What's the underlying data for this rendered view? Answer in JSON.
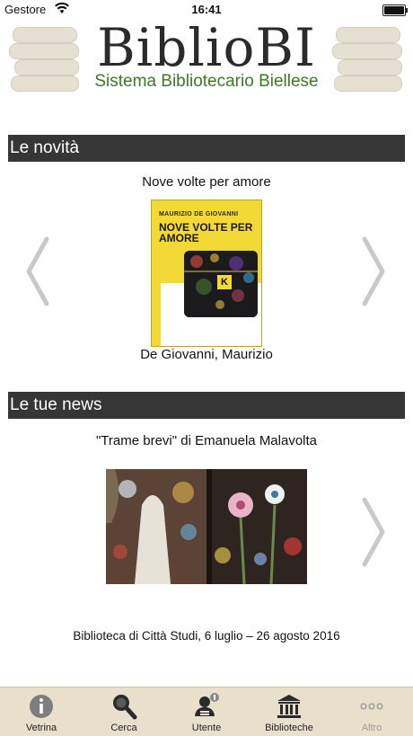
{
  "status_bar": {
    "carrier": "Gestore",
    "time": "16:41"
  },
  "header": {
    "title": "BiblioBI",
    "subtitle": "Sistema Bibliotecario Biellese"
  },
  "novita": {
    "section_label": "Le novità",
    "book_title": "Nove volte per amore",
    "book_author": "De Giovanni, Maurizio",
    "cover_author_text": "MAURIZIO DE GIOVANNI",
    "cover_title_text": "NOVE VOLTE PER AMORE",
    "cover_badge": "K"
  },
  "news": {
    "section_label": "Le tue news",
    "title": "\"Trame brevi\" di Emanuela Malavolta",
    "caption": "Biblioteca di Città Studi, 6 luglio – 26 agosto 2016"
  },
  "tabs": [
    {
      "label": "Vetrina",
      "icon": "info-icon",
      "active": true
    },
    {
      "label": "Cerca",
      "icon": "magnifier-icon",
      "active": true
    },
    {
      "label": "Utente",
      "icon": "user-icon",
      "active": true
    },
    {
      "label": "Biblioteche",
      "icon": "library-building-icon",
      "active": true
    },
    {
      "label": "Altro",
      "icon": "more-dots-icon",
      "active": false
    }
  ],
  "colors": {
    "section_bar": "#363636",
    "subtitle_green": "#3a7a22",
    "tab_bar_bg": "#e8e0cb",
    "cover_yellow": "#f2d936"
  }
}
